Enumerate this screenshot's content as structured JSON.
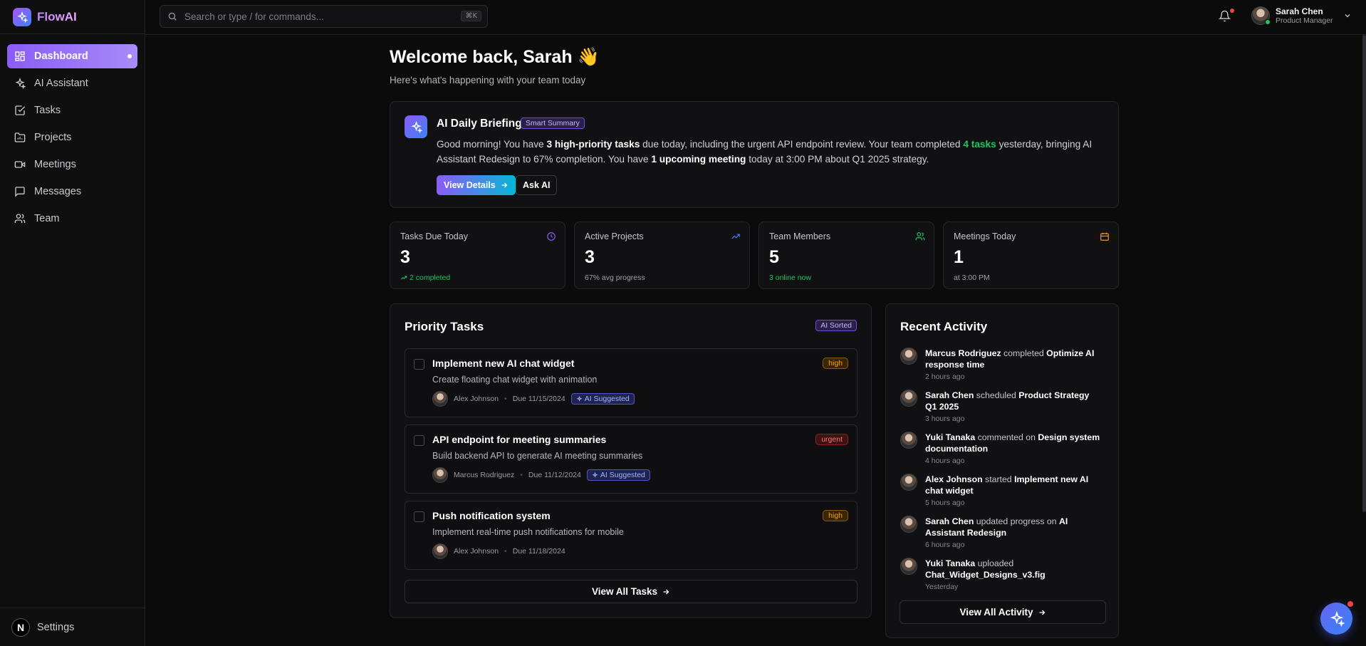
{
  "brand": {
    "name": "FlowAI",
    "accent": "#8b5cf6"
  },
  "search": {
    "placeholder": "Search or type / for commands...",
    "shortcut": "⌘K"
  },
  "user": {
    "name": "Sarah Chen",
    "role": "Product Manager"
  },
  "sidebar": {
    "items": [
      {
        "label": "Dashboard",
        "icon": "grid-icon"
      },
      {
        "label": "AI Assistant",
        "icon": "sparkles-icon"
      },
      {
        "label": "Tasks",
        "icon": "check-square-icon"
      },
      {
        "label": "Projects",
        "icon": "folder-icon"
      },
      {
        "label": "Meetings",
        "icon": "video-icon"
      },
      {
        "label": "Messages",
        "icon": "message-icon"
      },
      {
        "label": "Team",
        "icon": "users-icon"
      }
    ],
    "footer": {
      "badge": "N",
      "label": "Settings"
    }
  },
  "welcome": {
    "title": "Welcome back, Sarah 👋",
    "subtitle": "Here's what's happening with your team today"
  },
  "briefing": {
    "title": "AI Daily Briefing",
    "badge": "Smart Summary",
    "t1": "Good morning! You have ",
    "b1": "3 high-priority tasks",
    "t2": " due today, including the urgent API endpoint review. Your team completed ",
    "g1": "4 tasks",
    "t3": " yesterday, bringing AI Assistant Redesign to 67% completion. You have ",
    "b2": "1 upcoming meeting",
    "t4": " today at 3:00 PM about Q1 2025 strategy.",
    "primary_label": "View Details",
    "secondary_label": "Ask AI"
  },
  "stats": [
    {
      "label": "Tasks Due Today",
      "value": "3",
      "note": "2 completed",
      "icon": "clock-icon",
      "color": "#8b5cf6"
    },
    {
      "label": "Active Projects",
      "value": "3",
      "note": "67% avg progress",
      "icon": "trending-up-icon",
      "color": "#3b82f6"
    },
    {
      "label": "Team Members",
      "value": "5",
      "note": "3 online now",
      "icon": "users-icon",
      "color": "#22c55e"
    },
    {
      "label": "Meetings Today",
      "value": "1",
      "note": "at 3:00 PM",
      "icon": "calendar-icon",
      "color": "#f59e0b"
    }
  ],
  "tasks": {
    "title": "Priority Tasks",
    "badge": "AI Sorted",
    "items": [
      {
        "title": "Implement new AI chat widget",
        "desc": "Create floating chat widget with animation",
        "assignee": "Alex Johnson",
        "due": "Due 11/15/2024",
        "priority": "high",
        "ai": "AI Suggested"
      },
      {
        "title": "API endpoint for meeting summaries",
        "desc": "Build backend API to generate AI meeting summaries",
        "assignee": "Marcus Rodriguez",
        "due": "Due 11/12/2024",
        "priority": "urgent",
        "ai": "AI Suggested"
      },
      {
        "title": "Push notification system",
        "desc": "Implement real-time push notifications for mobile",
        "assignee": "Alex Johnson",
        "due": "Due 11/18/2024",
        "priority": "high",
        "ai": ""
      }
    ],
    "view_all": "View All Tasks"
  },
  "activity": {
    "title": "Recent Activity",
    "items": [
      {
        "user": "Marcus Rodriguez",
        "action": " completed ",
        "target": "Optimize AI response time",
        "time": "2 hours ago"
      },
      {
        "user": "Sarah Chen",
        "action": " scheduled ",
        "target": "Product Strategy Q1 2025",
        "time": "3 hours ago"
      },
      {
        "user": "Yuki Tanaka",
        "action": " commented on ",
        "target": "Design system documentation",
        "time": "4 hours ago"
      },
      {
        "user": "Alex Johnson",
        "action": " started ",
        "target": "Implement new AI chat widget",
        "time": "5 hours ago"
      },
      {
        "user": "Sarah Chen",
        "action": " updated progress on ",
        "target": "AI Assistant Redesign",
        "time": "6 hours ago"
      },
      {
        "user": "Yuki Tanaka",
        "action": " uploaded ",
        "target": "Chat_Widget_Designs_v3.fig",
        "time": "Yesterday"
      }
    ],
    "view_all": "View All Activity"
  }
}
